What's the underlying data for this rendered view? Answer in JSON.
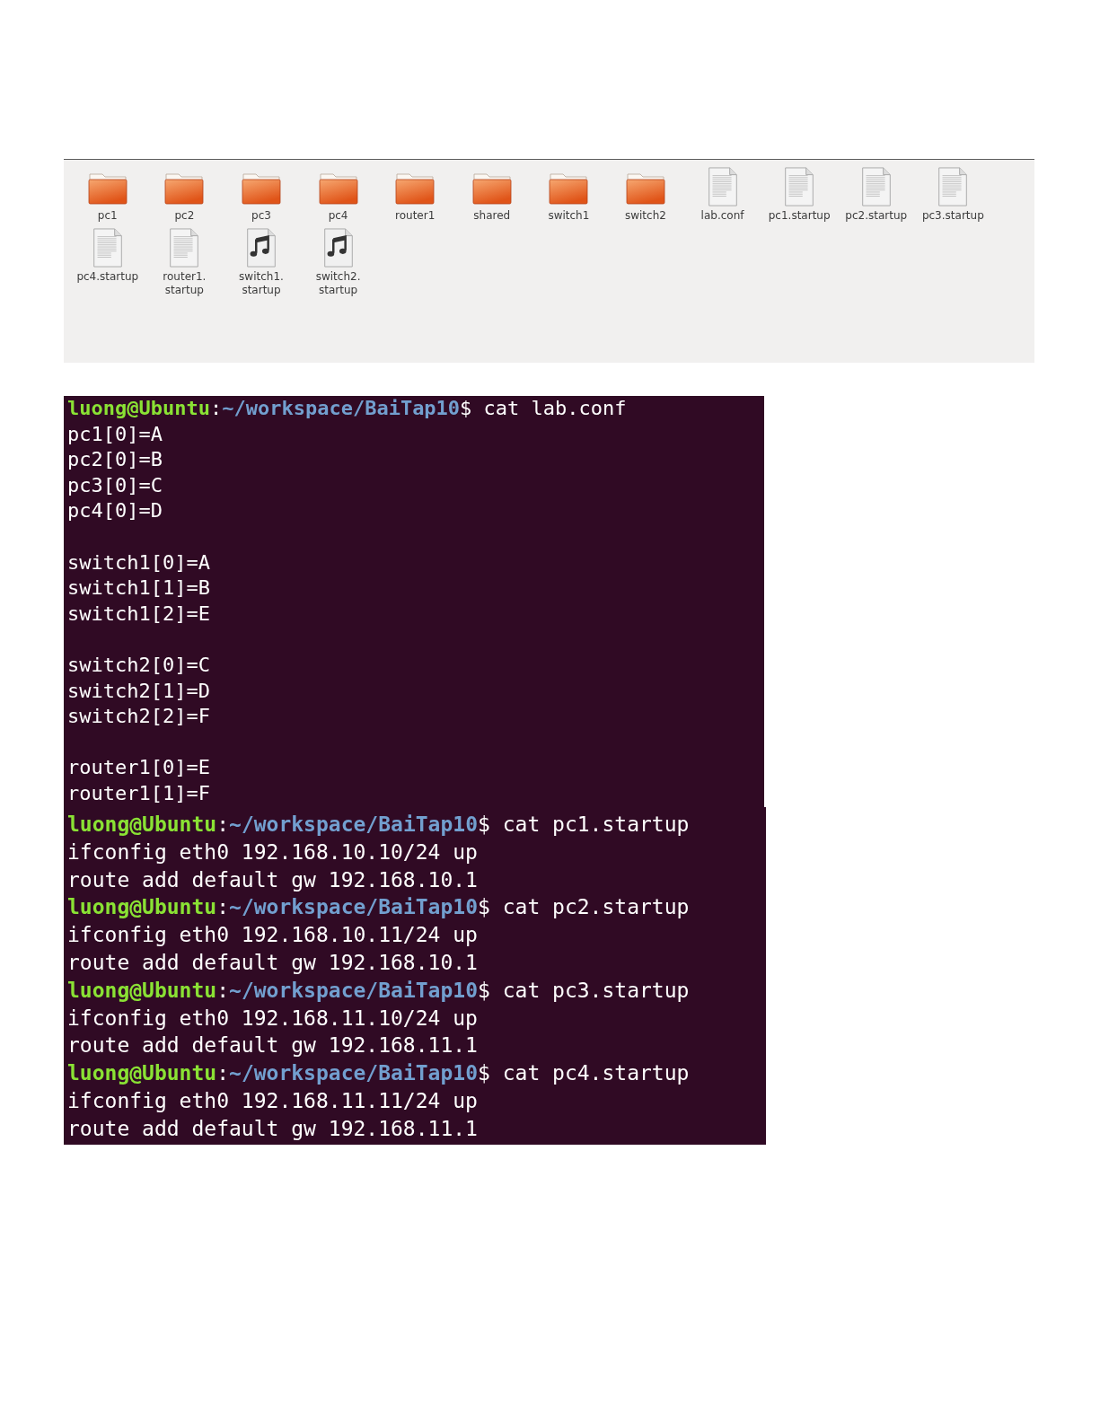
{
  "file_browser": {
    "items": [
      {
        "kind": "folder",
        "label": "pc1"
      },
      {
        "kind": "folder",
        "label": "pc2"
      },
      {
        "kind": "folder",
        "label": "pc3"
      },
      {
        "kind": "folder",
        "label": "pc4"
      },
      {
        "kind": "folder",
        "label": "router1"
      },
      {
        "kind": "folder",
        "label": "shared"
      },
      {
        "kind": "folder",
        "label": "switch1"
      },
      {
        "kind": "folder",
        "label": "switch2"
      },
      {
        "kind": "text",
        "label": "lab.conf"
      },
      {
        "kind": "text",
        "label": "pc1.startup"
      },
      {
        "kind": "text",
        "label": "pc2.startup"
      },
      {
        "kind": "text",
        "label": "pc3.startup"
      },
      {
        "kind": "text",
        "label": "pc4.startup"
      },
      {
        "kind": "text",
        "label": "router1.startup"
      },
      {
        "kind": "audio",
        "label": "switch1.startup"
      },
      {
        "kind": "audio",
        "label": "switch2.startup"
      }
    ]
  },
  "terminals": [
    {
      "sessions": [
        {
          "user_host": "luong@Ubuntu",
          "separator": ":",
          "path": "~/workspace/BaiTap10",
          "symbol": "$",
          "command": "cat lab.conf",
          "output_blocks": [
            [
              "pc1[0]=A",
              "pc2[0]=B",
              "pc3[0]=C",
              "pc4[0]=D"
            ],
            [
              "switch1[0]=A",
              "switch1[1]=B",
              "switch1[2]=E"
            ],
            [
              "switch2[0]=C",
              "switch2[1]=D",
              "switch2[2]=F"
            ],
            [
              "router1[0]=E",
              "router1[1]=F"
            ]
          ]
        }
      ]
    },
    {
      "sessions": [
        {
          "user_host": "luong@Ubuntu",
          "separator": ":",
          "path": "~/workspace/BaiTap10",
          "symbol": "$",
          "command": "cat pc1.startup",
          "output_blocks": [
            [
              "ifconfig eth0 192.168.10.10/24 up",
              "route add default gw 192.168.10.1"
            ]
          ]
        },
        {
          "user_host": "luong@Ubuntu",
          "separator": ":",
          "path": "~/workspace/BaiTap10",
          "symbol": "$",
          "command": "cat pc2.startup",
          "output_blocks": [
            [
              "ifconfig eth0 192.168.10.11/24 up",
              "route add default gw 192.168.10.1"
            ]
          ]
        },
        {
          "user_host": "luong@Ubuntu",
          "separator": ":",
          "path": "~/workspace/BaiTap10",
          "symbol": "$",
          "command": "cat pc3.startup",
          "output_blocks": [
            [
              "ifconfig eth0 192.168.11.10/24 up",
              "route add default gw 192.168.11.1"
            ]
          ]
        },
        {
          "user_host": "luong@Ubuntu",
          "separator": ":",
          "path": "~/workspace/BaiTap10",
          "symbol": "$",
          "command": "cat pc4.startup",
          "output_blocks": [
            [
              "ifconfig eth0 192.168.11.11/24 up",
              "route add default gw 192.168.11.1"
            ]
          ]
        }
      ]
    }
  ]
}
